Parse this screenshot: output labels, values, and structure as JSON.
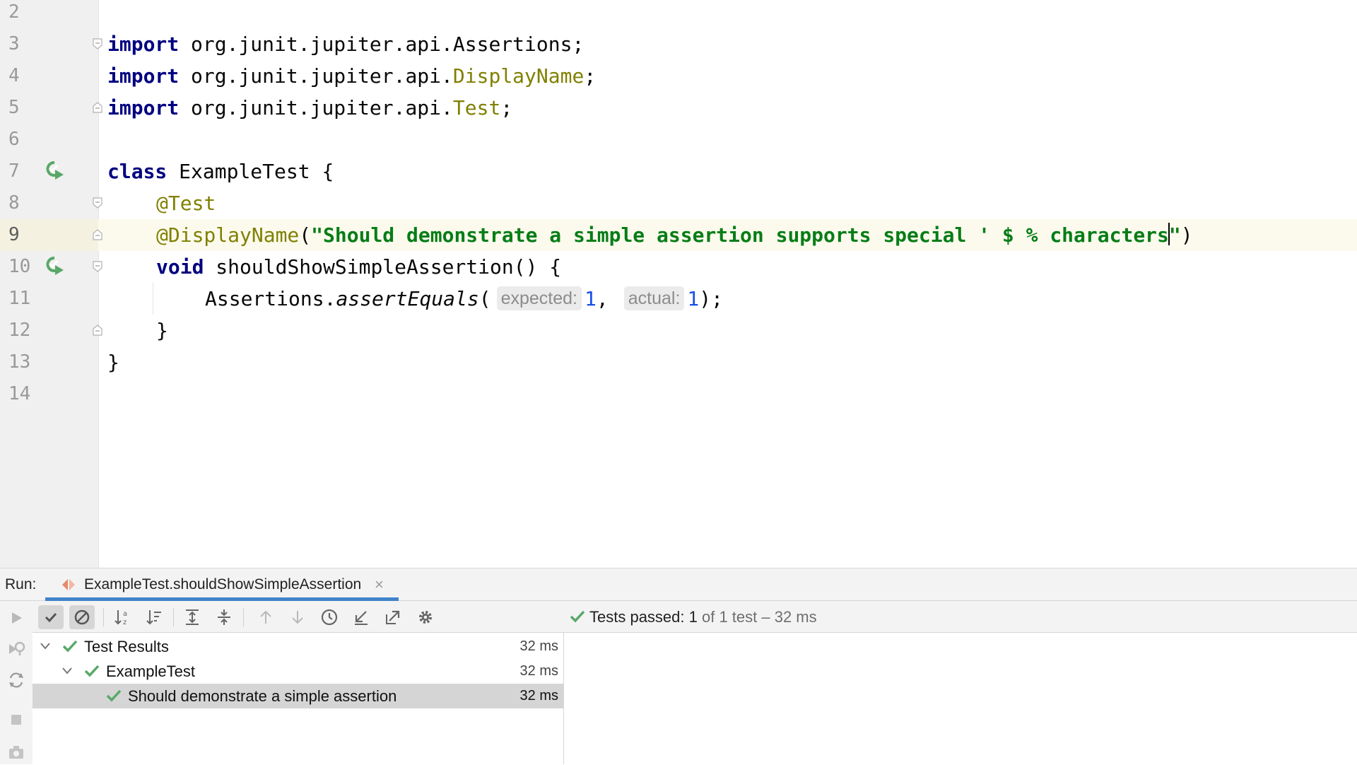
{
  "editor": {
    "lines": [
      {
        "num": "2"
      },
      {
        "num": "3",
        "import_kw": "import",
        "import_pkg": " org.junit.jupiter.api.",
        "import_cls": "Assertions",
        "import_end": ";"
      },
      {
        "num": "4",
        "import_kw": "import",
        "import_pkg": " org.junit.jupiter.api.",
        "import_cls": "DisplayName",
        "import_end": ";"
      },
      {
        "num": "5",
        "import_kw": "import",
        "import_pkg": " org.junit.jupiter.api.",
        "import_cls": "Test",
        "import_end": ";"
      },
      {
        "num": "6"
      },
      {
        "num": "7",
        "kw": "class",
        "rest": " ExampleTest {"
      },
      {
        "num": "8",
        "annotation": "@Test"
      },
      {
        "num": "9",
        "annotation": "@DisplayName",
        "open": "(",
        "string": "\"Should demonstrate a simple assertion supports special ' $ % characters",
        "string_end": "\"",
        "close": ")"
      },
      {
        "num": "10",
        "kw": "void",
        "rest": " shouldShowSimpleAssertion() {"
      },
      {
        "num": "11",
        "obj": "Assertions.",
        "method": "assertEquals",
        "open": "(",
        "hint1": "expected:",
        "val1": "1",
        "sep": ",",
        "hint2": "actual:",
        "val2": "1",
        "end": ");"
      },
      {
        "num": "12",
        "text": "}"
      },
      {
        "num": "13",
        "text": "}"
      },
      {
        "num": "14"
      }
    ]
  },
  "run_panel": {
    "run_label": "Run:",
    "tab_label": "ExampleTest.shouldShowSimpleAssertion",
    "tab_close": "×",
    "status_prefix": "Tests passed: 1",
    "status_suffix": " of 1 test – 32 ms",
    "tree": [
      {
        "label": "Test Results",
        "duration": "32 ms"
      },
      {
        "label": "ExampleTest",
        "duration": "32 ms"
      },
      {
        "label": "Should demonstrate a simple assertion",
        "duration": "32 ms",
        "selected": true
      }
    ]
  },
  "colors": {
    "keyword": "#000080",
    "annotation": "#808000",
    "string": "#067d17",
    "number": "#1750eb",
    "pass_green": "#59a869",
    "current_line": "#fcfaed",
    "tab_underline": "#4083c9"
  },
  "icons": [
    "run-test-icon",
    "fold-icon",
    "play-icon",
    "check-icon",
    "ignore-icon",
    "sort-alpha-icon",
    "sort-duration-icon",
    "expand-all-icon",
    "collapse-all-icon",
    "arrow-up-icon",
    "arrow-down-icon",
    "history-icon",
    "import-icon",
    "export-icon",
    "gear-icon",
    "rerun-failed-icon",
    "toggle-autotest-icon",
    "stop-icon",
    "camera-icon",
    "chevron-down-icon"
  ]
}
